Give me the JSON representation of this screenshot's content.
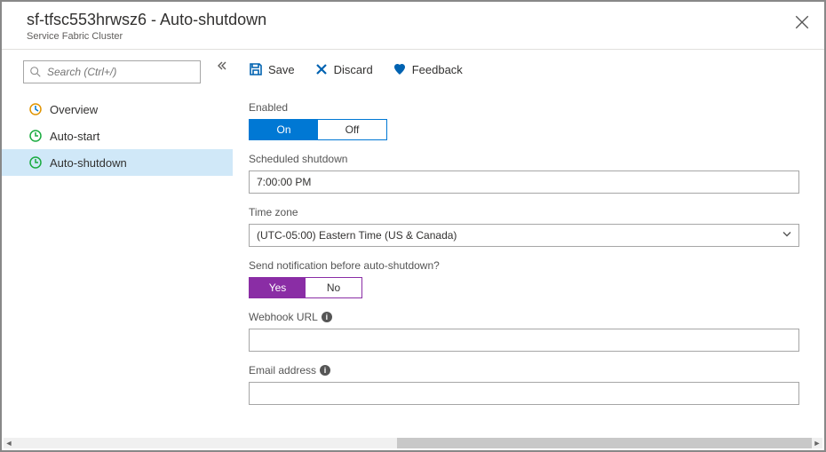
{
  "header": {
    "title": "sf-tfsc553hrwsz6 - Auto-shutdown",
    "subtitle": "Service Fabric Cluster"
  },
  "sidebar": {
    "search_placeholder": "Search (Ctrl+/)",
    "items": [
      {
        "label": "Overview"
      },
      {
        "label": "Auto-start"
      },
      {
        "label": "Auto-shutdown"
      }
    ]
  },
  "commands": {
    "save": "Save",
    "discard": "Discard",
    "feedback": "Feedback"
  },
  "form": {
    "enabled_label": "Enabled",
    "enabled_on": "On",
    "enabled_off": "Off",
    "enabled_value": "On",
    "scheduled_label": "Scheduled shutdown",
    "scheduled_value": "7:00:00 PM",
    "timezone_label": "Time zone",
    "timezone_value": "(UTC-05:00) Eastern Time (US & Canada)",
    "notify_label": "Send notification before auto-shutdown?",
    "notify_yes": "Yes",
    "notify_no": "No",
    "notify_value": "Yes",
    "webhook_label": "Webhook URL",
    "webhook_value": "",
    "email_label": "Email address",
    "email_value": ""
  }
}
